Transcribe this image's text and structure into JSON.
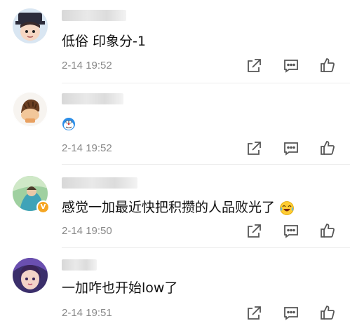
{
  "comments": [
    {
      "username": "",
      "text": "低俗 印象分-1",
      "time": "2-14 19:52",
      "emoji": ""
    },
    {
      "username": "",
      "text": "",
      "time": "2-14 19:52",
      "emoji": "doraemon-emoji"
    },
    {
      "username": "",
      "text": "感觉一加最近快把积攒的人品败光了",
      "time": "2-14 19:50",
      "emoji": "laugh-cry-emoji"
    },
    {
      "username": "",
      "text": "一加咋也开始low了",
      "time": "2-14 19:51",
      "emoji": ""
    }
  ],
  "icons": {
    "share": "share-icon",
    "comment": "comment-icon",
    "like": "like-icon"
  },
  "colors": {
    "time_text": "#888888",
    "icon_stroke": "#555555",
    "verified_badge": "#f5a623"
  }
}
